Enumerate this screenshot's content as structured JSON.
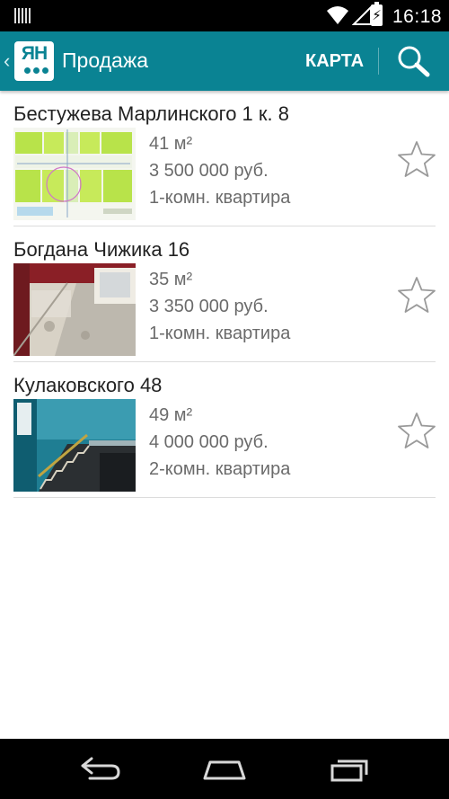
{
  "status_bar": {
    "time": "16:18",
    "icons": [
      "barcode-icon",
      "wifi-icon",
      "signal-icon",
      "battery-charging-icon"
    ]
  },
  "action_bar": {
    "logo_text": "ЯН",
    "title": "Продажа",
    "map_label": "КАРТА",
    "icons": [
      "back-icon",
      "search-icon"
    ],
    "color": "#0a8393"
  },
  "listings": [
    {
      "address": "Бестужева Марлинского 1 к. 8",
      "area": "41 м²",
      "price": "3 500 000 руб.",
      "rooms": "1-комн. квартира",
      "thumb": "floor-plan-image"
    },
    {
      "address": "Богдана Чижика 16",
      "area": "35 м²",
      "price": "3 350 000 руб.",
      "rooms": "1-комн. квартира",
      "thumb": "room-photo-image"
    },
    {
      "address": "Кулаковского 48",
      "area": "49 м²",
      "price": "4 000 000 руб.",
      "rooms": "2-комн. квартира",
      "thumb": "stairwell-photo-image"
    }
  ],
  "nav_bar": {
    "icons": [
      "back-nav-icon",
      "home-nav-icon",
      "recents-nav-icon"
    ]
  }
}
